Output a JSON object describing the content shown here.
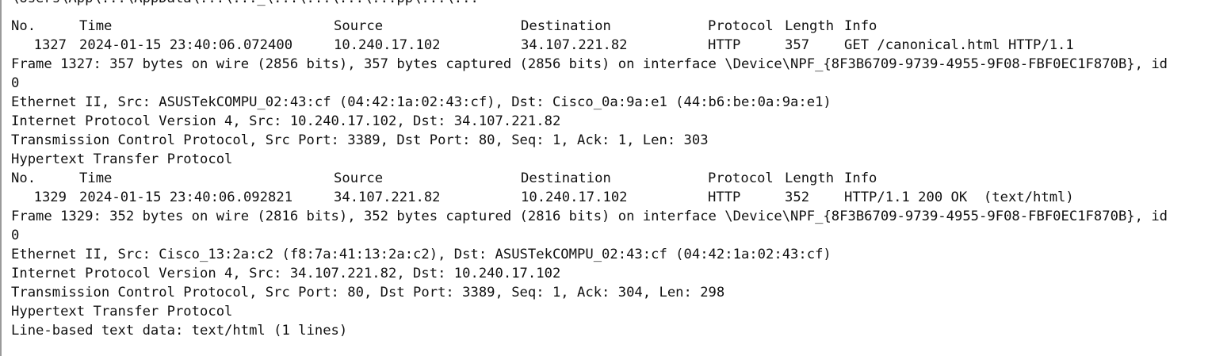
{
  "top_fragment": "\\Users\\App\\...\\AppData\\...\\..._\\...\\...\\...\\...pp\\...\\...",
  "headers": {
    "no": "No.",
    "time": "Time",
    "source": "Source",
    "destination": "Destination",
    "protocol": "Protocol",
    "length": "Length",
    "info": "Info"
  },
  "packets": [
    {
      "no": "1327",
      "time": "2024-01-15 23:40:06.072400",
      "source": "10.240.17.102",
      "destination": "34.107.221.82",
      "protocol": "HTTP",
      "length": "357",
      "info": "GET /canonical.html HTTP/1.1",
      "details": [
        "Frame 1327: 357 bytes on wire (2856 bits), 357 bytes captured (2856 bits) on interface \\Device\\NPF_{8F3B6709-9739-4955-9F08-FBF0EC1F870B}, id",
        "0",
        "Ethernet II, Src: ASUSTekCOMPU_02:43:cf (04:42:1a:02:43:cf), Dst: Cisco_0a:9a:e1 (44:b6:be:0a:9a:e1)",
        "Internet Protocol Version 4, Src: 10.240.17.102, Dst: 34.107.221.82",
        "Transmission Control Protocol, Src Port: 3389, Dst Port: 80, Seq: 1, Ack: 1, Len: 303",
        "Hypertext Transfer Protocol"
      ]
    },
    {
      "no": "1329",
      "time": "2024-01-15 23:40:06.092821",
      "source": "34.107.221.82",
      "destination": "10.240.17.102",
      "protocol": "HTTP",
      "length": "352",
      "info": "HTTP/1.1 200 OK  (text/html)",
      "details": [
        "Frame 1329: 352 bytes on wire (2816 bits), 352 bytes captured (2816 bits) on interface \\Device\\NPF_{8F3B6709-9739-4955-9F08-FBF0EC1F870B}, id",
        "0",
        "Ethernet II, Src: Cisco_13:2a:c2 (f8:7a:41:13:2a:c2), Dst: ASUSTekCOMPU_02:43:cf (04:42:1a:02:43:cf)",
        "Internet Protocol Version 4, Src: 34.107.221.82, Dst: 10.240.17.102",
        "Transmission Control Protocol, Src Port: 80, Dst Port: 3389, Seq: 1, Ack: 304, Len: 298",
        "Hypertext Transfer Protocol",
        "Line-based text data: text/html (1 lines)"
      ]
    }
  ]
}
